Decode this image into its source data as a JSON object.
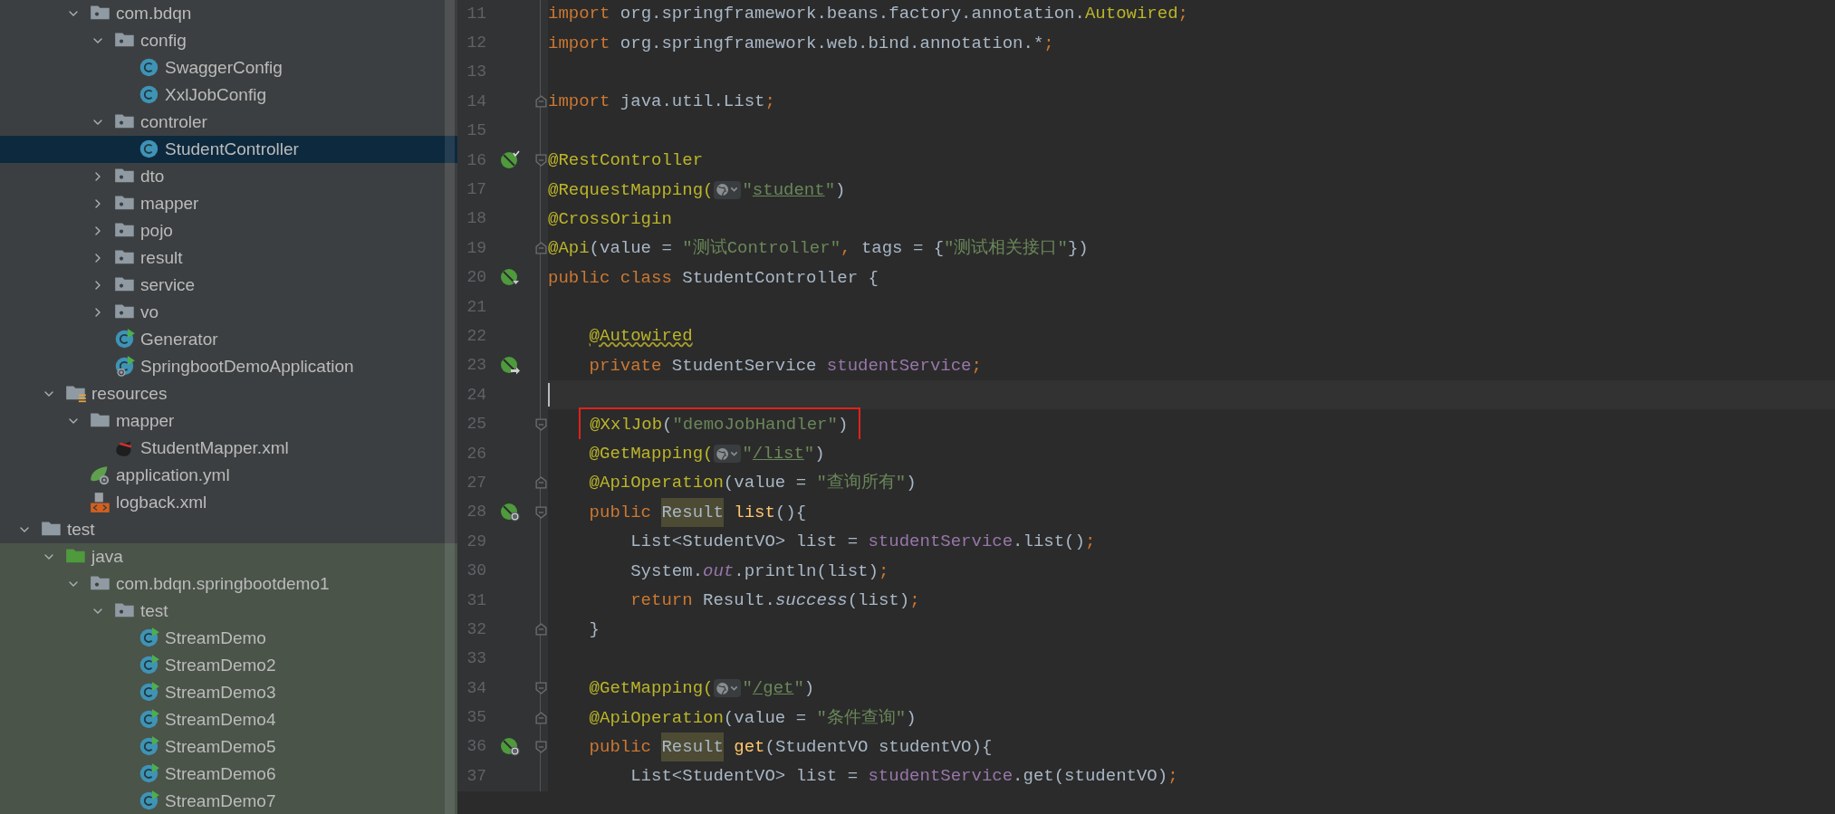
{
  "project_tree": {
    "items": [
      {
        "children": [
          {
            "children": [
              {
                "label": "com.bdqn",
                "kind": "package",
                "expanded": true,
                "selected": false,
                "children": [
                  {
                    "label": "config",
                    "kind": "package",
                    "expanded": true,
                    "selected": false,
                    "children": [
                      {
                        "label": "SwaggerConfig",
                        "kind": "class",
                        "selected": false
                      },
                      {
                        "label": "XxlJobConfig",
                        "kind": "class",
                        "selected": false
                      }
                    ]
                  },
                  {
                    "label": "controler",
                    "kind": "package",
                    "expanded": true,
                    "selected": false,
                    "children": [
                      {
                        "label": "StudentController",
                        "kind": "class",
                        "selected": true
                      }
                    ]
                  },
                  {
                    "label": "dto",
                    "kind": "package",
                    "expanded": false,
                    "selected": false
                  },
                  {
                    "label": "mapper",
                    "kind": "package",
                    "expanded": false,
                    "selected": false
                  },
                  {
                    "label": "pojo",
                    "kind": "package",
                    "expanded": false,
                    "selected": false
                  },
                  {
                    "label": "result",
                    "kind": "package",
                    "expanded": false,
                    "selected": false
                  },
                  {
                    "label": "service",
                    "kind": "package",
                    "expanded": false,
                    "selected": false
                  },
                  {
                    "label": "vo",
                    "kind": "package",
                    "expanded": false,
                    "selected": false
                  },
                  {
                    "label": "Generator",
                    "kind": "runnable",
                    "selected": false
                  },
                  {
                    "label": "SpringbootDemoApplication",
                    "kind": "boot",
                    "selected": false
                  }
                ]
              }
            ]
          },
          {
            "label": "resources",
            "kind": "resources",
            "expanded": true,
            "selected": false,
            "children": [
              {
                "label": "mapper",
                "kind": "folder",
                "expanded": true,
                "selected": false,
                "children": [
                  {
                    "label": "StudentMapper.xml",
                    "kind": "mybatis",
                    "selected": false
                  }
                ]
              },
              {
                "label": "application.yml",
                "kind": "yml",
                "selected": false
              },
              {
                "label": "logback.xml",
                "kind": "xml",
                "selected": false
              }
            ]
          }
        ]
      },
      {
        "label": "test",
        "kind": "folder",
        "expanded": true,
        "selected": false,
        "children": [
          {
            "label": "java",
            "kind": "testroot",
            "expanded": true,
            "tinted": true,
            "selected": false,
            "children": [
              {
                "label": "com.bdqn.springbootdemo1",
                "kind": "package",
                "expanded": true,
                "selected": false,
                "children": [
                  {
                    "label": "test",
                    "kind": "package",
                    "expanded": true,
                    "selected": false,
                    "children": [
                      {
                        "label": "StreamDemo",
                        "kind": "runnable",
                        "selected": false
                      },
                      {
                        "label": "StreamDemo2",
                        "kind": "runnable",
                        "selected": false
                      },
                      {
                        "label": "StreamDemo3",
                        "kind": "runnable",
                        "selected": false
                      },
                      {
                        "label": "StreamDemo4",
                        "kind": "runnable",
                        "selected": false
                      },
                      {
                        "label": "StreamDemo5",
                        "kind": "runnable",
                        "selected": false
                      },
                      {
                        "label": "StreamDemo6",
                        "kind": "runnable",
                        "selected": false
                      },
                      {
                        "label": "StreamDemo7",
                        "kind": "runnable",
                        "selected": false
                      }
                    ]
                  }
                ]
              }
            ]
          }
        ]
      }
    ]
  },
  "editor": {
    "lines": [
      {
        "number": "11",
        "current": false,
        "tokens": [
          {
            "kind": "kw",
            "text": "import"
          },
          {
            "kind": "plain",
            "text": " org.springframework.beans.factory.annotation."
          },
          {
            "kind": "ann",
            "text": "Autowired"
          },
          {
            "kind": "punct",
            "text": ";"
          }
        ]
      },
      {
        "number": "12",
        "current": false,
        "tokens": [
          {
            "kind": "kw",
            "text": "import"
          },
          {
            "kind": "plain",
            "text": " org.springframework.web.bind.annotation.*"
          },
          {
            "kind": "punct",
            "text": ";"
          }
        ]
      },
      {
        "number": "13",
        "current": false
      },
      {
        "number": "14",
        "current": false,
        "fold": {
          "kind": "end"
        },
        "tokens": [
          {
            "kind": "kw",
            "text": "import"
          },
          {
            "kind": "plain",
            "text": " java.util.List"
          },
          {
            "kind": "punct",
            "text": ";"
          }
        ]
      },
      {
        "number": "15",
        "current": false
      },
      {
        "number": "16",
        "current": false,
        "fold": {
          "kind": "start"
        },
        "gutter": {
          "kind": "check"
        },
        "tokens": [
          {
            "kind": "ann",
            "text": "@RestController"
          }
        ]
      },
      {
        "number": "17",
        "current": false,
        "tokens": [
          {
            "kind": "ann",
            "text": "@RequestMapping("
          },
          {
            "kind": "inlay"
          },
          {
            "kind": "str",
            "text": "\""
          },
          {
            "kind": "link",
            "text": "student"
          },
          {
            "kind": "str",
            "text": "\""
          },
          {
            "kind": "plain",
            "text": ")"
          }
        ]
      },
      {
        "number": "18",
        "current": false,
        "tokens": [
          {
            "kind": "ann",
            "text": "@CrossOrigin"
          }
        ]
      },
      {
        "number": "19",
        "current": false,
        "fold": {
          "kind": "end"
        },
        "tokens": [
          {
            "kind": "ann",
            "text": "@Api"
          },
          {
            "kind": "plain",
            "text": "(value = "
          },
          {
            "kind": "str",
            "text": "\"测试Controller\""
          },
          {
            "kind": "punct",
            "text": ", "
          },
          {
            "kind": "plain",
            "text": "tags = {"
          },
          {
            "kind": "str",
            "text": "\"测试相关接口\""
          },
          {
            "kind": "plain",
            "text": "})"
          }
        ]
      },
      {
        "number": "20",
        "current": false,
        "gutter": {
          "kind": "down"
        },
        "tokens": [
          {
            "kind": "kw",
            "text": "public class "
          },
          {
            "kind": "plain",
            "text": "StudentController {"
          }
        ]
      },
      {
        "number": "21",
        "current": false
      },
      {
        "number": "22",
        "current": false,
        "tokens": [
          {
            "kind": "ann-warn",
            "text": "    @Autowired"
          }
        ]
      },
      {
        "number": "23",
        "current": false,
        "gutter": {
          "kind": "arrow"
        },
        "tokens": [
          {
            "kind": "kw",
            "text": "    private "
          },
          {
            "kind": "plain",
            "text": "StudentService "
          },
          {
            "kind": "field",
            "text": "studentService"
          },
          {
            "kind": "punct",
            "text": ";"
          }
        ]
      },
      {
        "number": "24",
        "current": true
      },
      {
        "number": "25",
        "current": false,
        "fold": {
          "kind": "start"
        },
        "boxed": true,
        "tokens": [
          {
            "kind": "ann",
            "text": "    @XxlJob"
          },
          {
            "kind": "plain",
            "text": "("
          },
          {
            "kind": "str",
            "text": "\"demoJobHandler\""
          },
          {
            "kind": "plain",
            "text": ")"
          }
        ]
      },
      {
        "number": "26",
        "current": false,
        "tokens": [
          {
            "kind": "ann",
            "text": "    @GetMapping("
          },
          {
            "kind": "inlay"
          },
          {
            "kind": "str",
            "text": "\""
          },
          {
            "kind": "link",
            "text": "/list"
          },
          {
            "kind": "str",
            "text": "\""
          },
          {
            "kind": "plain",
            "text": ")"
          }
        ]
      },
      {
        "number": "27",
        "current": false,
        "fold": {
          "kind": "end"
        },
        "tokens": [
          {
            "kind": "ann",
            "text": "    @ApiOperation"
          },
          {
            "kind": "plain",
            "text": "(value = "
          },
          {
            "kind": "str",
            "text": "\"查询所有\""
          },
          {
            "kind": "plain",
            "text": ")"
          }
        ]
      },
      {
        "number": "28",
        "current": false,
        "fold": {
          "kind": "start"
        },
        "gutter": {
          "kind": "web"
        },
        "tokens": [
          {
            "kind": "kw",
            "text": "    public "
          },
          {
            "kind": "hl",
            "text": "Result"
          },
          {
            "kind": "method",
            "text": " list"
          },
          {
            "kind": "plain",
            "text": "(){"
          }
        ]
      },
      {
        "number": "29",
        "current": false,
        "tokens": [
          {
            "kind": "plain",
            "text": "        List<StudentVO> list = "
          },
          {
            "kind": "field",
            "text": "studentService"
          },
          {
            "kind": "plain",
            "text": ".list()"
          },
          {
            "kind": "punct",
            "text": ";"
          }
        ]
      },
      {
        "number": "30",
        "current": false,
        "tokens": [
          {
            "kind": "plain",
            "text": "        System."
          },
          {
            "kind": "static",
            "text": "out"
          },
          {
            "kind": "plain",
            "text": ".println(list)"
          },
          {
            "kind": "punct",
            "text": ";"
          }
        ]
      },
      {
        "number": "31",
        "current": false,
        "tokens": [
          {
            "kind": "kw",
            "text": "        return "
          },
          {
            "kind": "plain",
            "text": "Result."
          },
          {
            "kind": "italic",
            "text": "success"
          },
          {
            "kind": "plain",
            "text": "(list)"
          },
          {
            "kind": "punct",
            "text": ";"
          }
        ]
      },
      {
        "number": "32",
        "current": false,
        "fold": {
          "kind": "end"
        },
        "tokens": [
          {
            "kind": "plain",
            "text": "    }"
          }
        ]
      },
      {
        "number": "33",
        "current": false
      },
      {
        "number": "34",
        "current": false,
        "fold": {
          "kind": "start"
        },
        "tokens": [
          {
            "kind": "ann",
            "text": "    @GetMapping("
          },
          {
            "kind": "inlay"
          },
          {
            "kind": "str",
            "text": "\""
          },
          {
            "kind": "link",
            "text": "/get"
          },
          {
            "kind": "str",
            "text": "\""
          },
          {
            "kind": "plain",
            "text": ")"
          }
        ]
      },
      {
        "number": "35",
        "current": false,
        "fold": {
          "kind": "end"
        },
        "tokens": [
          {
            "kind": "ann",
            "text": "    @ApiOperation"
          },
          {
            "kind": "plain",
            "text": "(value = "
          },
          {
            "kind": "str",
            "text": "\"条件查询\""
          },
          {
            "kind": "plain",
            "text": ")"
          }
        ]
      },
      {
        "number": "36",
        "current": false,
        "fold": {
          "kind": "start"
        },
        "gutter": {
          "kind": "web"
        },
        "tokens": [
          {
            "kind": "kw",
            "text": "    public "
          },
          {
            "kind": "hl",
            "text": "Result"
          },
          {
            "kind": "method",
            "text": " get"
          },
          {
            "kind": "plain",
            "text": "(StudentVO studentVO){"
          }
        ]
      },
      {
        "number": "37",
        "current": false,
        "tokens": [
          {
            "kind": "plain",
            "text": "        List<StudentVO> list = "
          },
          {
            "kind": "field",
            "text": "studentService"
          },
          {
            "kind": "plain",
            "text": ".get(studentVO)"
          },
          {
            "kind": "punct",
            "text": ";"
          }
        ]
      }
    ]
  }
}
